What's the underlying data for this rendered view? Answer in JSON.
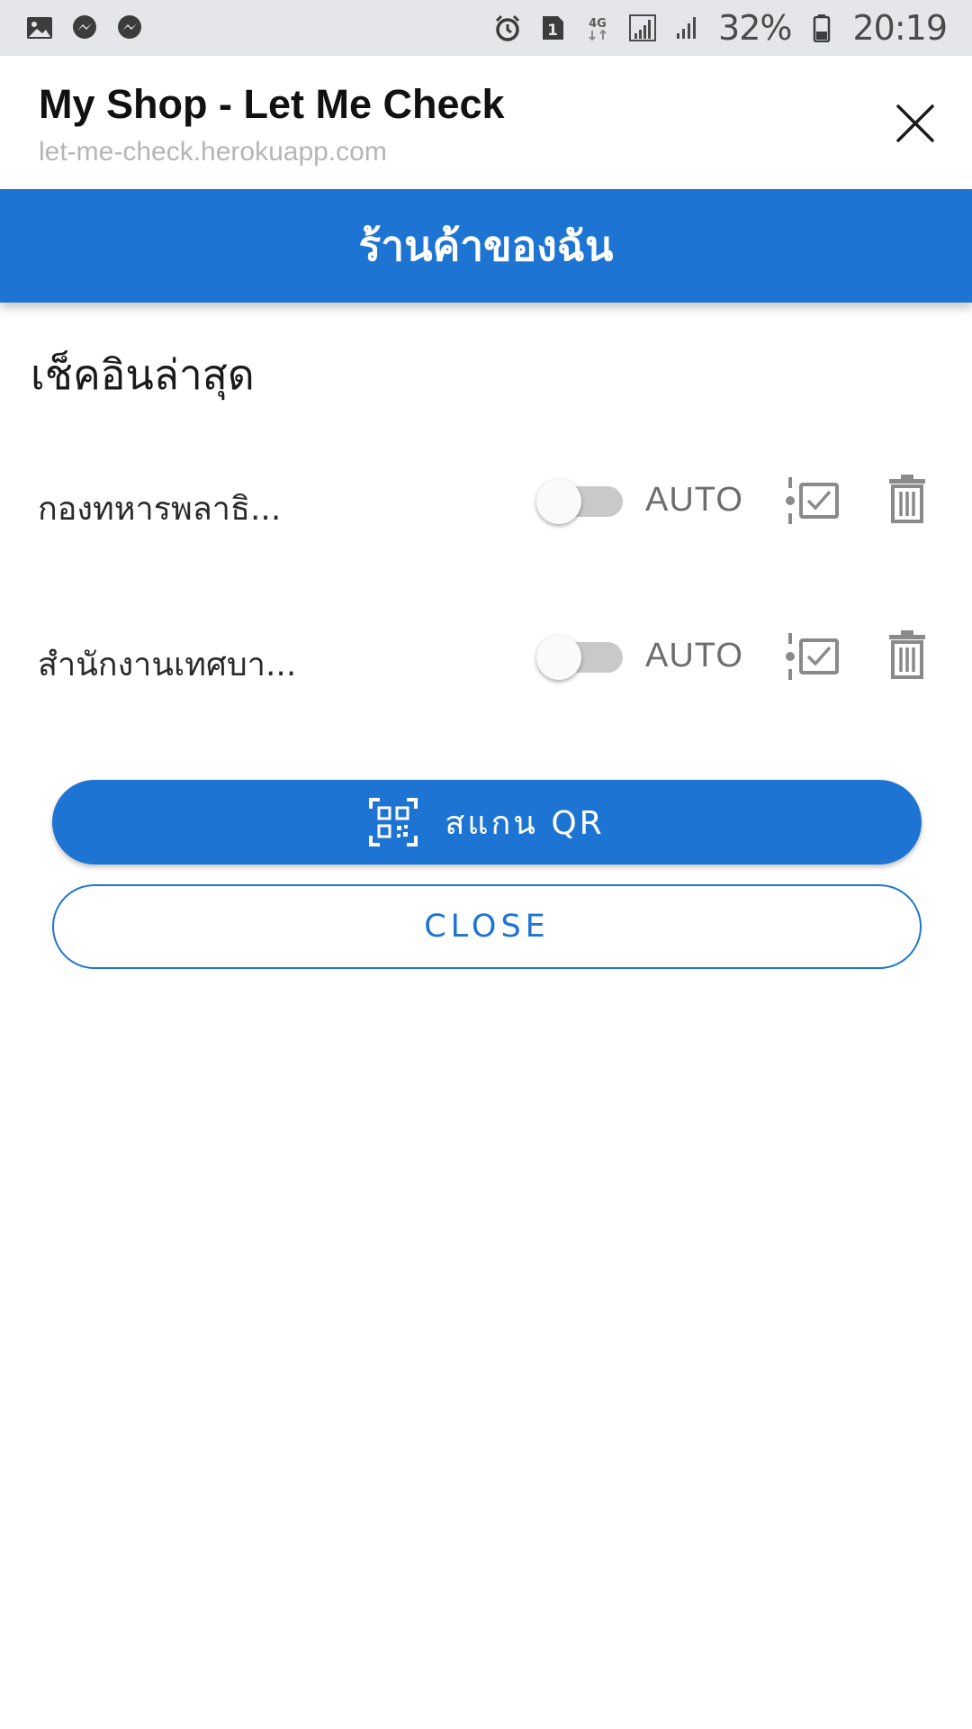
{
  "status_bar": {
    "left_icons": [
      "gallery-icon",
      "messenger-icon",
      "messenger-icon"
    ],
    "right_icons": [
      "alarm-icon",
      "sim-1-icon",
      "4g-icon",
      "signal-icon",
      "signal-icon",
      "battery-icon"
    ],
    "network": "4G",
    "sim": "1",
    "battery": "32%",
    "time": "20:19"
  },
  "browser": {
    "title": "My Shop - Let Me Check",
    "url": "let-me-check.herokuapp.com",
    "close_icon": "close-icon"
  },
  "app_bar": {
    "title": "ร้านค้าของฉัน"
  },
  "section": {
    "title": "เช็คอินล่าสุด"
  },
  "checkins": [
    {
      "name": "กองทหารพลาธิ...",
      "auto_label": "AUTO",
      "auto_enabled": false
    },
    {
      "name": "สำนักงานเทศบา...",
      "auto_label": "AUTO",
      "auto_enabled": false
    }
  ],
  "buttons": {
    "scan_label": "สแกน QR",
    "scan_icon": "qr-code-icon",
    "close_label": "CLOSE"
  },
  "colors": {
    "primary": "#1d74d3",
    "status_bar_bg": "#e4e6ea",
    "toggle_off": "#c9c9c9",
    "icon_gray": "#8a8a8a"
  }
}
